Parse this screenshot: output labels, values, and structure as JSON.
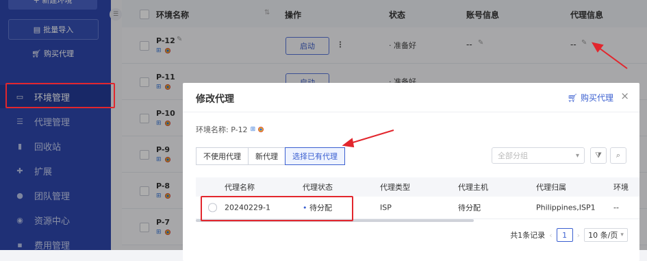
{
  "sidebar": {
    "new_env": "+ 新建环境",
    "batch_import": "批量导入",
    "buy_proxy": "购买代理",
    "items": [
      {
        "label": "环境管理",
        "icon": "monitor-icon"
      },
      {
        "label": "代理管理",
        "icon": "list-icon"
      },
      {
        "label": "回收站",
        "icon": "trash-icon"
      },
      {
        "label": "扩展",
        "icon": "puzzle-icon"
      },
      {
        "label": "团队管理",
        "icon": "team-icon"
      },
      {
        "label": "资源中心",
        "icon": "resource-icon"
      },
      {
        "label": "费用管理",
        "icon": "billing-icon"
      }
    ]
  },
  "table": {
    "headers": {
      "name": "环境名称",
      "ops": "操作",
      "status": "状态",
      "account": "账号信息",
      "proxy": "代理信息"
    },
    "rows": [
      {
        "name": "P-12",
        "start": "启动",
        "status": "准备好",
        "account": "--",
        "proxy": "--"
      },
      {
        "name": "P-11",
        "start": "启动",
        "status": "准备好",
        "account": "",
        "proxy": ""
      },
      {
        "name": "P-10"
      },
      {
        "name": "P-9"
      },
      {
        "name": "P-8"
      },
      {
        "name": "P-7"
      }
    ]
  },
  "modal": {
    "title": "修改代理",
    "buy_proxy": "购买代理",
    "close": "×",
    "env_label": "环境名称: P-12",
    "tabs": [
      "不使用代理",
      "新代理",
      "选择已有代理"
    ],
    "group_placeholder": "全部分组",
    "columns": [
      "代理名称",
      "代理状态",
      "代理类型",
      "代理主机",
      "代理归属",
      "环境"
    ],
    "proxies": [
      {
        "name": "20240229-1",
        "status": "待分配",
        "type": "ISP",
        "host": "待分配",
        "owner": "Philippines,ISP1",
        "env": "--"
      }
    ],
    "pager": {
      "total": "共1条记录",
      "page": "1",
      "size": "10 条/页"
    }
  },
  "colors": {
    "sidebar": "#2f48ae",
    "accent": "#3a5fd0",
    "highlight": "#e2262d"
  }
}
